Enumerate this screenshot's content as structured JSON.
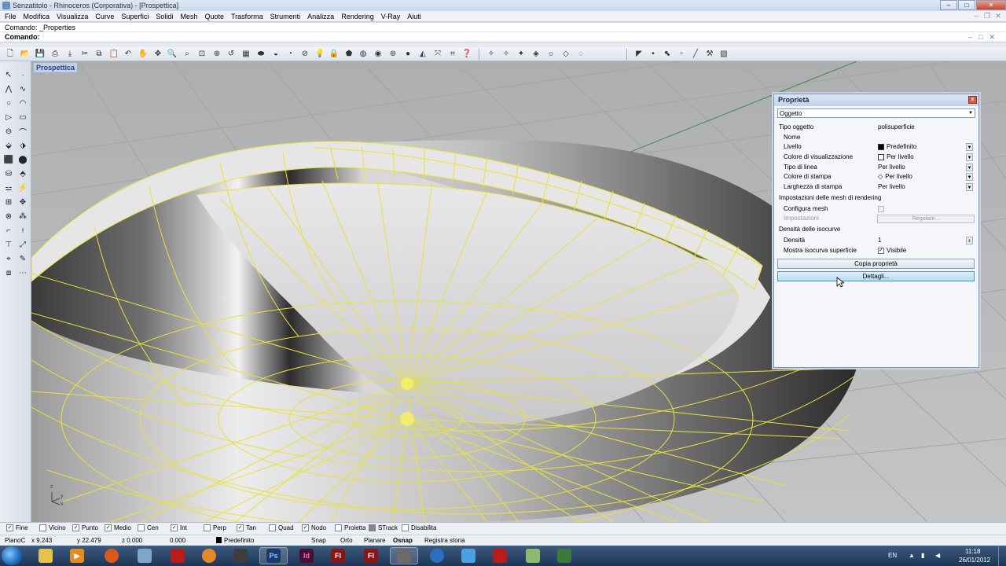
{
  "window": {
    "title": "Senzatitolo - Rhinoceros (Corporativa) - [Prospettica]",
    "buttons": [
      "–",
      "□",
      "✕"
    ]
  },
  "menu": [
    "File",
    "Modifica",
    "Visualizza",
    "Curve",
    "Superfici",
    "Solidi",
    "Mesh",
    "Quote",
    "Trasforma",
    "Strumenti",
    "Analizza",
    "Rendering",
    "V-Ray",
    "Aiuti"
  ],
  "command": {
    "history": "Comando: _Properties",
    "prompt": "Comando:"
  },
  "viewport": {
    "label": "Prospettica",
    "axis_z": "z",
    "axis_y": "y",
    "axis_x": "x"
  },
  "properties": {
    "title": "Proprietà",
    "close": "x",
    "selector": "Oggetto",
    "tipo_oggetto_label": "Tipo oggetto",
    "tipo_oggetto_value": "polisuperficie",
    "nome_label": "Nome",
    "livello_label": "Livello",
    "livello_value": "Predefinito",
    "colore_vis_label": "Colore di visualizzazione",
    "colore_vis_value": "Per livello",
    "tipo_linea_label": "Tipo di linea",
    "tipo_linea_value": "Per livello",
    "colore_stampa_label": "Colore di stampa",
    "colore_stampa_value": "Per livello",
    "larghezza_stampa_label": "Larghezza di stampa",
    "larghezza_stampa_value": "Per livello",
    "mesh_section": "Impostazioni delle mesh di rendering",
    "configura_mesh_label": "Configura mesh",
    "impostazioni_label": "Impostazioni",
    "regolare_label": "Regolare...",
    "isocurve_section": "Densità delle isocurve",
    "densita_label": "Densità",
    "densita_value": "1",
    "mostra_iso_label": "Mostra isocurva superficie",
    "mostra_iso_value": "Visibile",
    "copia_button": "Copia proprietà",
    "dettagli_button": "Dettagli..."
  },
  "osnap": {
    "fine": "Fine",
    "vicino": "Vicino",
    "punto": "Punto",
    "medio": "Medio",
    "cen": "Cen",
    "int": "Int",
    "perp": "Perp",
    "tan": "Tan",
    "quad": "Quad",
    "nodo": "Nodo",
    "proietta": "Proietta",
    "strack": "STrack",
    "disabilita": "Disabilita"
  },
  "status": {
    "plane": "PianoC",
    "x": "x 9.243",
    "y": "y 22.479",
    "z": "z 0.000",
    "dist": "0.000",
    "layer": "Predefinito",
    "snap": "Snap",
    "orto": "Orto",
    "planare": "Planare",
    "osnap": "Osnap",
    "storia": "Registra storia"
  },
  "taskbar": {
    "apps": [
      "Ps",
      "Id",
      "Fl",
      "Fl"
    ],
    "lang": "EN",
    "time": "11:18",
    "date": "26/01/2012"
  },
  "colors": {
    "isocurve": "#e8e23c",
    "viewport_bg": "#b5b6b8",
    "panel_border": "#7f93b2"
  }
}
